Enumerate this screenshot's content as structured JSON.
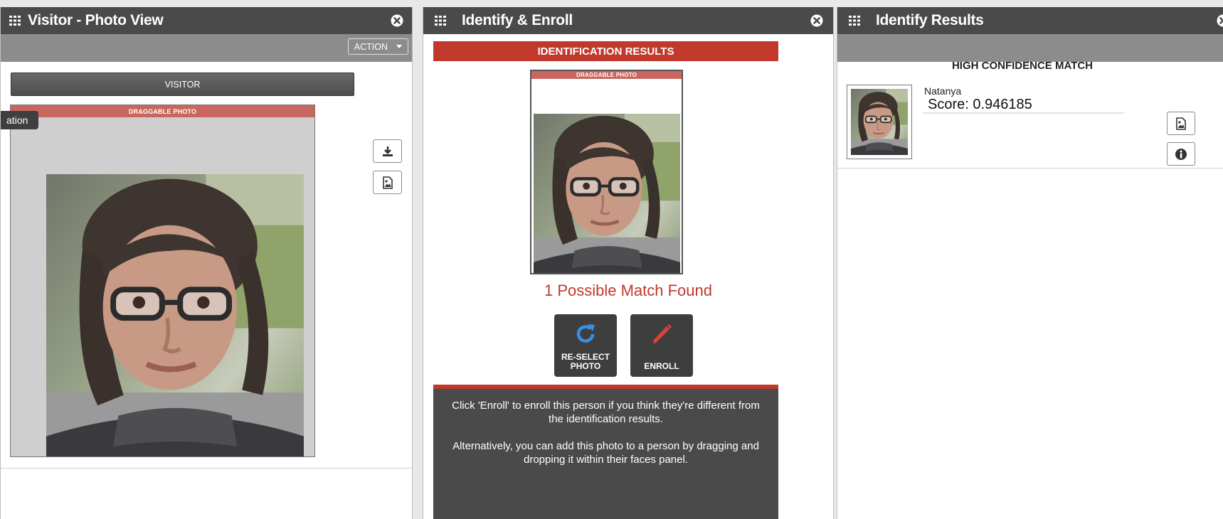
{
  "panels": {
    "photo_view": {
      "title": "Visitor - Photo View",
      "action_label": "ACTION",
      "visitor_label": "VISITOR",
      "drag_label": "DRAGGABLE PHOTO",
      "tooltip_fragment": "ation"
    },
    "identify_enroll": {
      "title": "Identify & Enroll",
      "banner": "IDENTIFICATION RESULTS",
      "drag_label": "DRAGGABLE PHOTO",
      "match_text": "1 Possible Match Found",
      "reselect_line1": "RE-SELECT",
      "reselect_line2": "PHOTO",
      "enroll_label": "ENROLL",
      "info_line1": "Click 'Enroll' to enroll this person if you think they're different from the identification results.",
      "info_line2": "Alternatively, you can add this photo to a person by dragging and dropping it within their faces panel."
    },
    "identify_results": {
      "title": "Identify Results",
      "heading": "HIGH CONFIDENCE MATCH",
      "match_name": "Natanya",
      "match_score": "Score: 0.946185"
    }
  },
  "icons": {
    "grid": "grid-icon",
    "close": "close-icon",
    "download": "download-icon",
    "image": "image-icon",
    "info": "info-icon",
    "refresh": "refresh-icon",
    "pencil": "pencil-icon"
  },
  "colors": {
    "header_bg": "#4a4a4a",
    "subbar_bg": "#8c8c8c",
    "accent_red": "#c0392b",
    "drag_label_bg": "#c9675e",
    "tile_bg": "#3e3e3e",
    "refresh_blue": "#3a8ee6",
    "pencil_red": "#e0403a"
  }
}
